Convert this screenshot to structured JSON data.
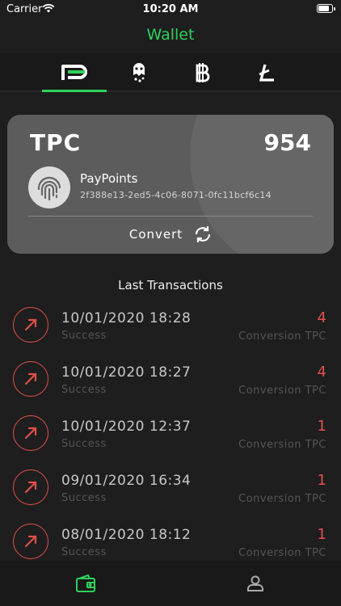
{
  "status_bar": {
    "carrier": "Carrier",
    "time": "10:20 AM"
  },
  "header": {
    "title": "Wallet"
  },
  "tabs": [
    {
      "label": "PayPoints",
      "icon": "paypoints-icon",
      "active": true
    },
    {
      "label": "Token",
      "icon": "token-icon",
      "active": false
    },
    {
      "label": "Bitcoin",
      "icon": "bitcoin-icon",
      "active": false
    },
    {
      "label": "Litecoin",
      "icon": "litecoin-icon",
      "active": false
    }
  ],
  "card": {
    "currency": "TPC",
    "amount": "954",
    "account_name": "PayPoints",
    "account_id": "2f388e13-2ed5-4c06-8071-0fc11bcf6c14",
    "convert_label": "Convert",
    "avatar_icon": "fingerprint-icon",
    "convert_icon": "refresh-icon"
  },
  "transactions_title": "Last Transactions",
  "transactions": [
    {
      "date": "10/01/2020 18:28",
      "status": "Success",
      "amount": "4",
      "type": "Conversion TPC"
    },
    {
      "date": "10/01/2020 18:27",
      "status": "Success",
      "amount": "4",
      "type": "Conversion TPC"
    },
    {
      "date": "10/01/2020 12:37",
      "status": "Success",
      "amount": "1",
      "type": "Conversion TPC"
    },
    {
      "date": "09/01/2020 16:34",
      "status": "Success",
      "amount": "1",
      "type": "Conversion TPC"
    },
    {
      "date": "08/01/2020 18:12",
      "status": "Success",
      "amount": "1",
      "type": "Conversion TPC"
    }
  ],
  "bottom_nav": [
    {
      "icon": "wallet-icon",
      "active": true
    },
    {
      "icon": "profile-icon",
      "active": false
    }
  ],
  "colors": {
    "accent": "#2fd15c",
    "negative": "#e0504a",
    "background": "#1e1e1e",
    "card": "#5c5c5c"
  }
}
